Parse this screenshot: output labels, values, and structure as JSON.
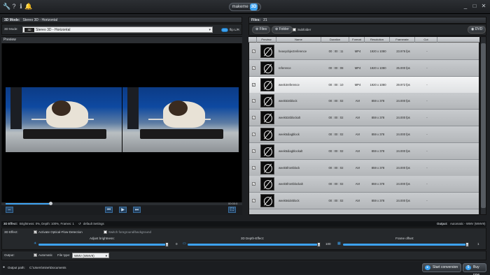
{
  "titlebar": {
    "logo_text": "makeme",
    "logo_badge": "3D",
    "left_icons": [
      "wrench-icon",
      "question-icon",
      "info-icon",
      "bell-icon"
    ],
    "controls": [
      "_",
      "□",
      "✕"
    ]
  },
  "left_panel": {
    "header_label": "3D Mode:",
    "header_value": "Stereo 3D - Horizontal",
    "mode_label": "3D Mode:",
    "mode_icon": "3D",
    "mode_value": "Stereo 3D - Horizontal",
    "flip_label": "flip L/R",
    "preview_label": "Preview",
    "time": "00:00:0"
  },
  "right_panel": {
    "files_label": "Files:",
    "files_count": "21",
    "files_button": "Files",
    "folder_button": "Folder",
    "subfolder_label": "Subfolder",
    "dvd_button": "DVD",
    "columns": [
      "",
      "Preview",
      "Name",
      "Duration",
      "Format",
      "Resolution",
      "Framerate",
      "Cut"
    ],
    "rows": [
      {
        "checked": true,
        "name": "heavyobjectreference",
        "duration": "00 : 00 : 11",
        "format": "MP4",
        "resolution": "1920 x 1080",
        "framerate": "23.976 fps",
        "cut": "-",
        "selected": false
      },
      {
        "checked": true,
        "name": "reference",
        "duration": "00 : 00 : 08",
        "format": "MP4",
        "resolution": "1920 x 1080",
        "framerate": "25.000 fps",
        "cut": "-",
        "selected": false
      },
      {
        "checked": true,
        "name": "week4reference",
        "duration": "00 : 00 : 10",
        "format": "MP4",
        "resolution": "1920 x 1080",
        "framerate": "29.972 fps",
        "cut": "-",
        "selected": true
      },
      {
        "checked": true,
        "name": "week534block",
        "duration": "00 : 00 : 02",
        "format": "AVI",
        "resolution": "859 x 378",
        "framerate": "24.000 fps",
        "cut": "-",
        "selected": false
      },
      {
        "checked": true,
        "name": "week534blockalt",
        "duration": "00 : 00 : 02",
        "format": "AVI",
        "resolution": "859 x 378",
        "framerate": "24.000 fps",
        "cut": "-",
        "selected": false
      },
      {
        "checked": true,
        "name": "week5diagblock",
        "duration": "00 : 00 : 02",
        "format": "AVI",
        "resolution": "859 x 378",
        "framerate": "24.000 fps",
        "cut": "-",
        "selected": false
      },
      {
        "checked": true,
        "name": "week5diagblockalt",
        "duration": "00 : 00 : 02",
        "format": "AVI",
        "resolution": "859 x 378",
        "framerate": "24.000 fps",
        "cut": "-",
        "selected": false
      },
      {
        "checked": true,
        "name": "week5frontblock",
        "duration": "00 : 00 : 02",
        "format": "AVI",
        "resolution": "859 x 378",
        "framerate": "24.000 fps",
        "cut": "-",
        "selected": false
      },
      {
        "checked": true,
        "name": "week5frontblockalt",
        "duration": "00 : 00 : 02",
        "format": "AVI",
        "resolution": "859 x 378",
        "framerate": "24.000 fps",
        "cut": "-",
        "selected": false
      },
      {
        "checked": true,
        "name": "week5sideblock",
        "duration": "00 : 00 : 02",
        "format": "AVI",
        "resolution": "859 x 378",
        "framerate": "24.000 fps",
        "cut": "-",
        "selected": false
      }
    ]
  },
  "status": {
    "effect_label": "3D Effect:",
    "effect_summary": "Brightness: 0%, Depth: 100%, Frames: 1",
    "default_settings": "default Settings",
    "output_label": "Output:",
    "output_summary": "Automatic - WMV (WMV9)"
  },
  "effect": {
    "label": "3D Effect:",
    "optical_flow": "Activate Optical-Flow-Detection",
    "switch_fg": "Switch foreground/background",
    "brightness_label": "Adjust brightness:",
    "brightness_value": "0",
    "brightness_level": 1.0,
    "depth_label": "3D Depth-Effect:",
    "depth_value": "100",
    "depth_level": 1.0,
    "frame_label": "Frame offset:",
    "frame_value": "1",
    "frame_level": 1.0
  },
  "output": {
    "label": "Output:",
    "automatic": "Automatic",
    "filetype_label": "File type:",
    "filetype_value": "WMV (WMV9)",
    "path_label": "Output path:",
    "path_value": "C:\\Users\\mine\\Documents",
    "start_button": "Start conversion",
    "buy_button": "Buy now"
  },
  "colors": {
    "accent": "#3da2f0",
    "background": "#1e2023"
  }
}
